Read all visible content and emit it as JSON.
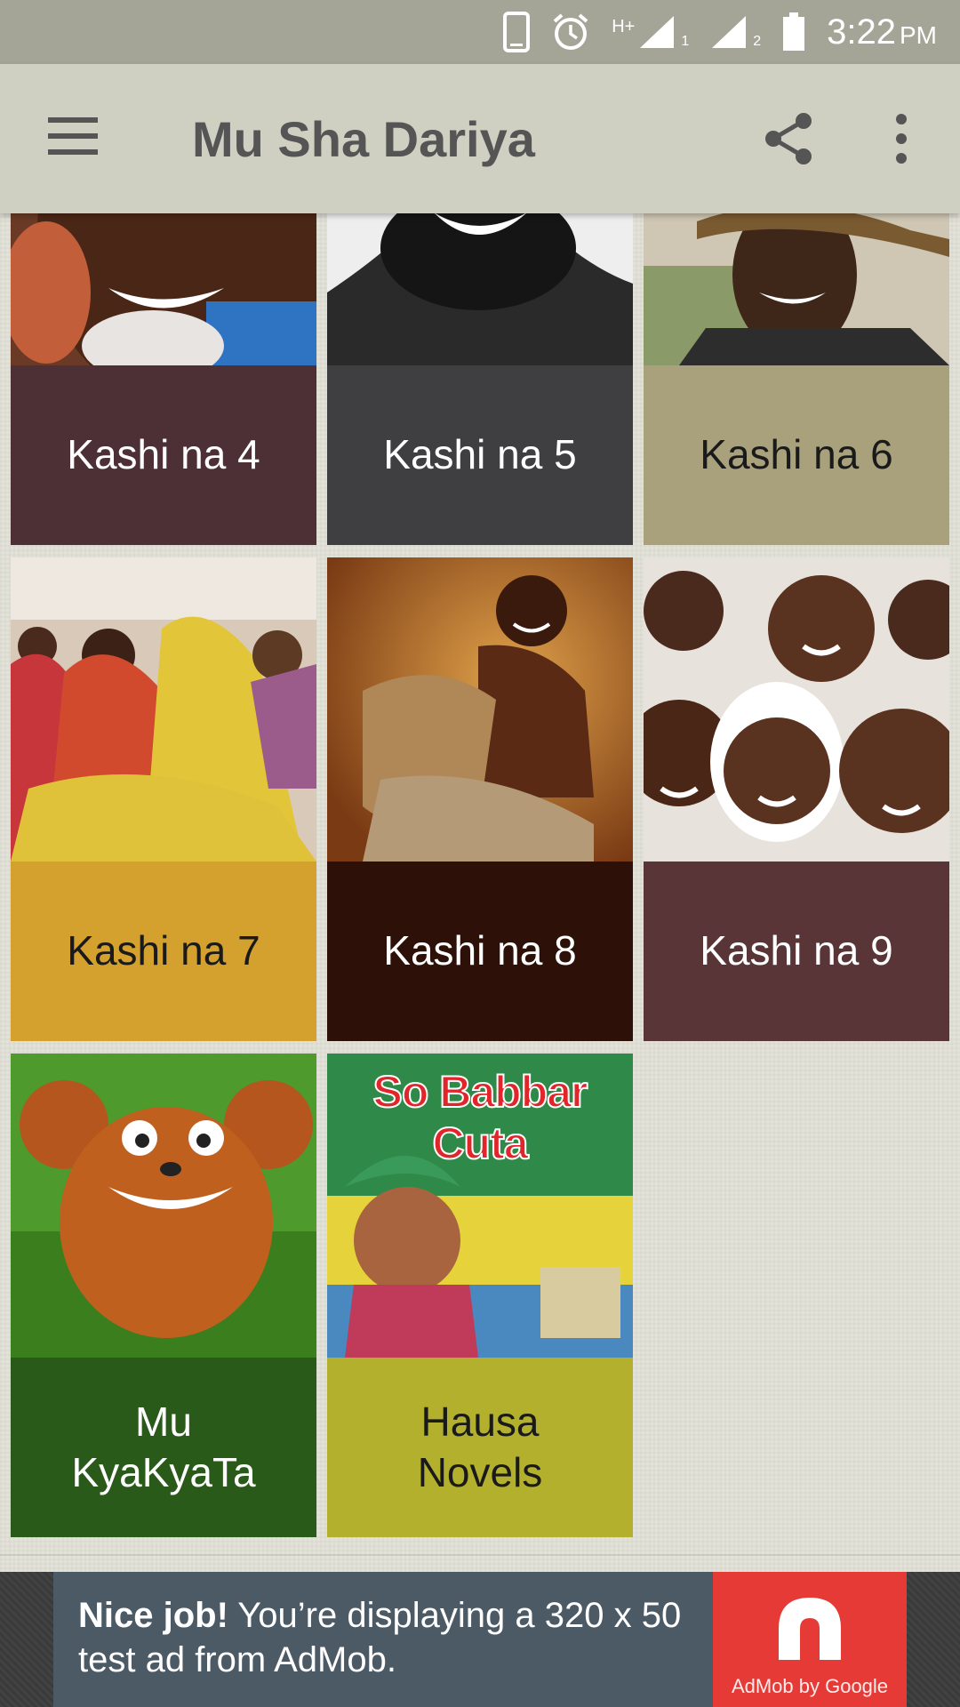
{
  "status_bar": {
    "time": "3:22",
    "ampm": "PM",
    "network": "H+",
    "sim1": "1",
    "sim2": "2",
    "icons": [
      "phone-icon",
      "alarm-icon",
      "signal-icon",
      "battery-icon"
    ]
  },
  "toolbar": {
    "title": "Mu Sha Dariya",
    "icons": [
      "menu-icon",
      "share-icon",
      "more-vert-icon"
    ]
  },
  "tiles": [
    {
      "label": "Kashi na 4",
      "color": "#4d2f36",
      "text_color": "#ffffff"
    },
    {
      "label": "Kashi na 5",
      "color": "#3f3f42",
      "text_color": "#ffffff"
    },
    {
      "label": "Kashi na 6",
      "color": "#a8a17c",
      "text_color": "#1a1a1a"
    },
    {
      "label": "Kashi na 7",
      "color": "#d4a12e",
      "text_color": "#1a1a1a"
    },
    {
      "label": "Kashi na 8",
      "color": "#2d1108",
      "text_color": "#ffffff"
    },
    {
      "label": "Kashi na 9",
      "color": "#5a3537",
      "text_color": "#ffffff"
    },
    {
      "label": "Mu KyaKyaTa",
      "color": "#2a5a1a",
      "text_color": "#ffffff"
    },
    {
      "label": "Hausa Novels",
      "color": "#b3b02e",
      "text_color": "#1a1a1a"
    }
  ],
  "novel_cover_text": "So Babbar Cuta",
  "ad": {
    "headline": "Nice job!",
    "body": " You’re displaying a 320 x 50 test ad from AdMob.",
    "logo_text": "AdMob by Google",
    "logo_color": "#e53a35"
  }
}
